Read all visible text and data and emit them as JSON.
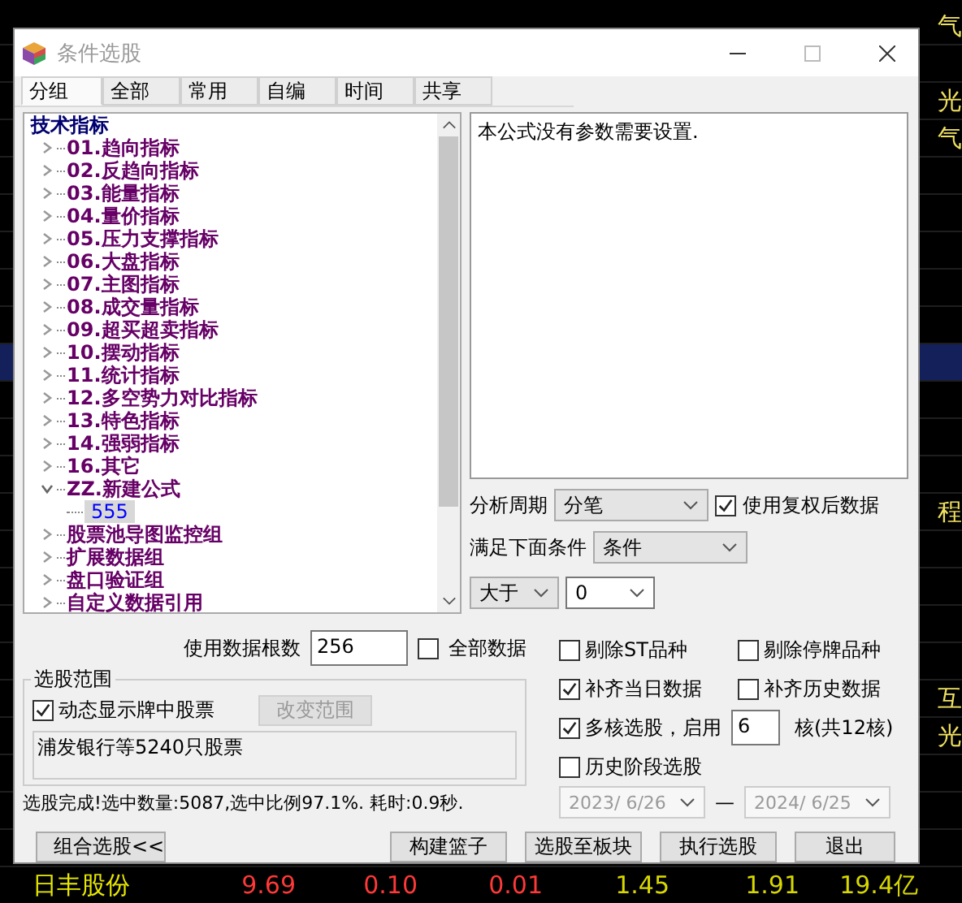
{
  "background_table": {
    "rows": [
      {
        "cells": [],
        "side": "气",
        "selected": false
      },
      {
        "cells": [],
        "side": "",
        "selected": false
      },
      {
        "cells": [],
        "side": "光",
        "selected": false
      },
      {
        "cells": [],
        "side": "气",
        "selected": false
      },
      {
        "cells": [],
        "side": "",
        "selected": false
      },
      {
        "cells": [],
        "side": "",
        "selected": false
      },
      {
        "cells": [],
        "side": "",
        "selected": false
      },
      {
        "cells": [],
        "side": "",
        "selected": false
      },
      {
        "cells": [],
        "side": "",
        "selected": false
      },
      {
        "cells": [],
        "side": "",
        "selected": true
      },
      {
        "cells": [],
        "side": "",
        "selected": false
      },
      {
        "cells": [],
        "side": "",
        "selected": false
      },
      {
        "cells": [],
        "side": "",
        "selected": false
      },
      {
        "cells": [],
        "side": "程",
        "selected": false
      },
      {
        "cells": [],
        "side": "",
        "selected": false
      },
      {
        "cells": [],
        "side": "",
        "selected": false
      },
      {
        "cells": [],
        "side": "",
        "selected": false
      },
      {
        "cells": [],
        "side": "",
        "selected": false
      },
      {
        "cells": [],
        "side": "互",
        "selected": false
      },
      {
        "cells": [],
        "side": "光",
        "selected": false
      },
      {
        "cells": [],
        "side": "",
        "selected": false
      },
      {
        "cells": [],
        "side": "",
        "selected": false
      },
      {
        "cells": [],
        "side": "",
        "selected": false
      },
      {
        "cells": [
          "日丰股份",
          "9.69",
          "0.10",
          "0.01",
          "1.45",
          "1.91",
          "19.4亿"
        ],
        "side": "",
        "selected": false
      }
    ]
  },
  "window": {
    "title": "条件选股"
  },
  "tabs": [
    {
      "label": "分组",
      "selected": true
    },
    {
      "label": "全部",
      "selected": false
    },
    {
      "label": "常用",
      "selected": false
    },
    {
      "label": "自编",
      "selected": false
    },
    {
      "label": "时间",
      "selected": false
    },
    {
      "label": "共享",
      "selected": false
    }
  ],
  "tree": [
    {
      "label": "技术指标",
      "kind": "root",
      "selected": false,
      "children": [
        {
          "label": "01.趋向指标",
          "kind": "group",
          "expanded": false,
          "selected": false
        },
        {
          "label": "02.反趋向指标",
          "kind": "group",
          "expanded": false,
          "selected": false
        },
        {
          "label": "03.能量指标",
          "kind": "group",
          "expanded": false,
          "selected": false
        },
        {
          "label": "04.量价指标",
          "kind": "group",
          "expanded": false,
          "selected": false
        },
        {
          "label": "05.压力支撑指标",
          "kind": "group",
          "expanded": false,
          "selected": false
        },
        {
          "label": "06.大盘指标",
          "kind": "group",
          "expanded": false,
          "selected": false
        },
        {
          "label": "07.主图指标",
          "kind": "group",
          "expanded": false,
          "selected": false
        },
        {
          "label": "08.成交量指标",
          "kind": "group",
          "expanded": false,
          "selected": false
        },
        {
          "label": "09.超买超卖指标",
          "kind": "group",
          "expanded": false,
          "selected": false
        },
        {
          "label": "10.摆动指标",
          "kind": "group",
          "expanded": false,
          "selected": false
        },
        {
          "label": "11.统计指标",
          "kind": "group",
          "expanded": false,
          "selected": false
        },
        {
          "label": "12.多空势力对比指标",
          "kind": "group",
          "expanded": false,
          "selected": false
        },
        {
          "label": "13.特色指标",
          "kind": "group",
          "expanded": false,
          "selected": false
        },
        {
          "label": "14.强弱指标",
          "kind": "group",
          "expanded": false,
          "selected": false
        },
        {
          "label": "16.其它",
          "kind": "group",
          "expanded": false,
          "selected": false
        },
        {
          "label": "ZZ.新建公式",
          "kind": "group",
          "expanded": true,
          "selected": false,
          "children": [
            {
              "label": "555",
              "kind": "formula",
              "selected": true
            }
          ]
        },
        {
          "label": "股票池导图监控组",
          "kind": "group",
          "expanded": false,
          "selected": false
        },
        {
          "label": "扩展数据组",
          "kind": "group",
          "expanded": false,
          "selected": false
        },
        {
          "label": "盘口验证组",
          "kind": "group",
          "expanded": false,
          "selected": false
        },
        {
          "label": "自定义数据引用",
          "kind": "group",
          "expanded": false,
          "selected": false
        }
      ]
    }
  ],
  "param_text": "本公式没有参数需要设置.",
  "period": {
    "label": "分析周期",
    "value": "分笔"
  },
  "adjusted": {
    "label": "使用复权后数据",
    "checked": true
  },
  "condition": {
    "label": "满足下面条件",
    "value": "条件"
  },
  "compare": {
    "operator": "大于",
    "value": "0"
  },
  "data_count": {
    "label": "使用数据根数",
    "value": "256"
  },
  "all_data": {
    "label": "全部数据",
    "checked": false
  },
  "scope": {
    "title": "选股范围",
    "dynamic": {
      "label": "动态显示牌中股票",
      "checked": true
    },
    "change_button": {
      "label": "改变范围",
      "disabled": true
    },
    "summary": "浦发银行等5240只股票"
  },
  "status": "选股完成!选中数量:5087,选中比例97.1%. 耗时:0.9秒.",
  "options": [
    {
      "label": "剔除ST品种",
      "checked": false
    },
    {
      "label": "剔除停牌品种",
      "checked": false
    },
    {
      "label": "补齐当日数据",
      "checked": true
    },
    {
      "label": "补齐历史数据",
      "checked": false
    }
  ],
  "multicore": {
    "label": "多核选股，启用",
    "checked": true,
    "value": "6",
    "suffix": "核(共12核)"
  },
  "history": {
    "label": "历史阶段选股",
    "checked": false,
    "from": "2023/ 6/26",
    "separator": "—",
    "to": "2024/ 6/25"
  },
  "buttons": [
    "组合选股<<",
    "构建篮子",
    "选股至板块",
    "执行选股",
    "退出"
  ]
}
